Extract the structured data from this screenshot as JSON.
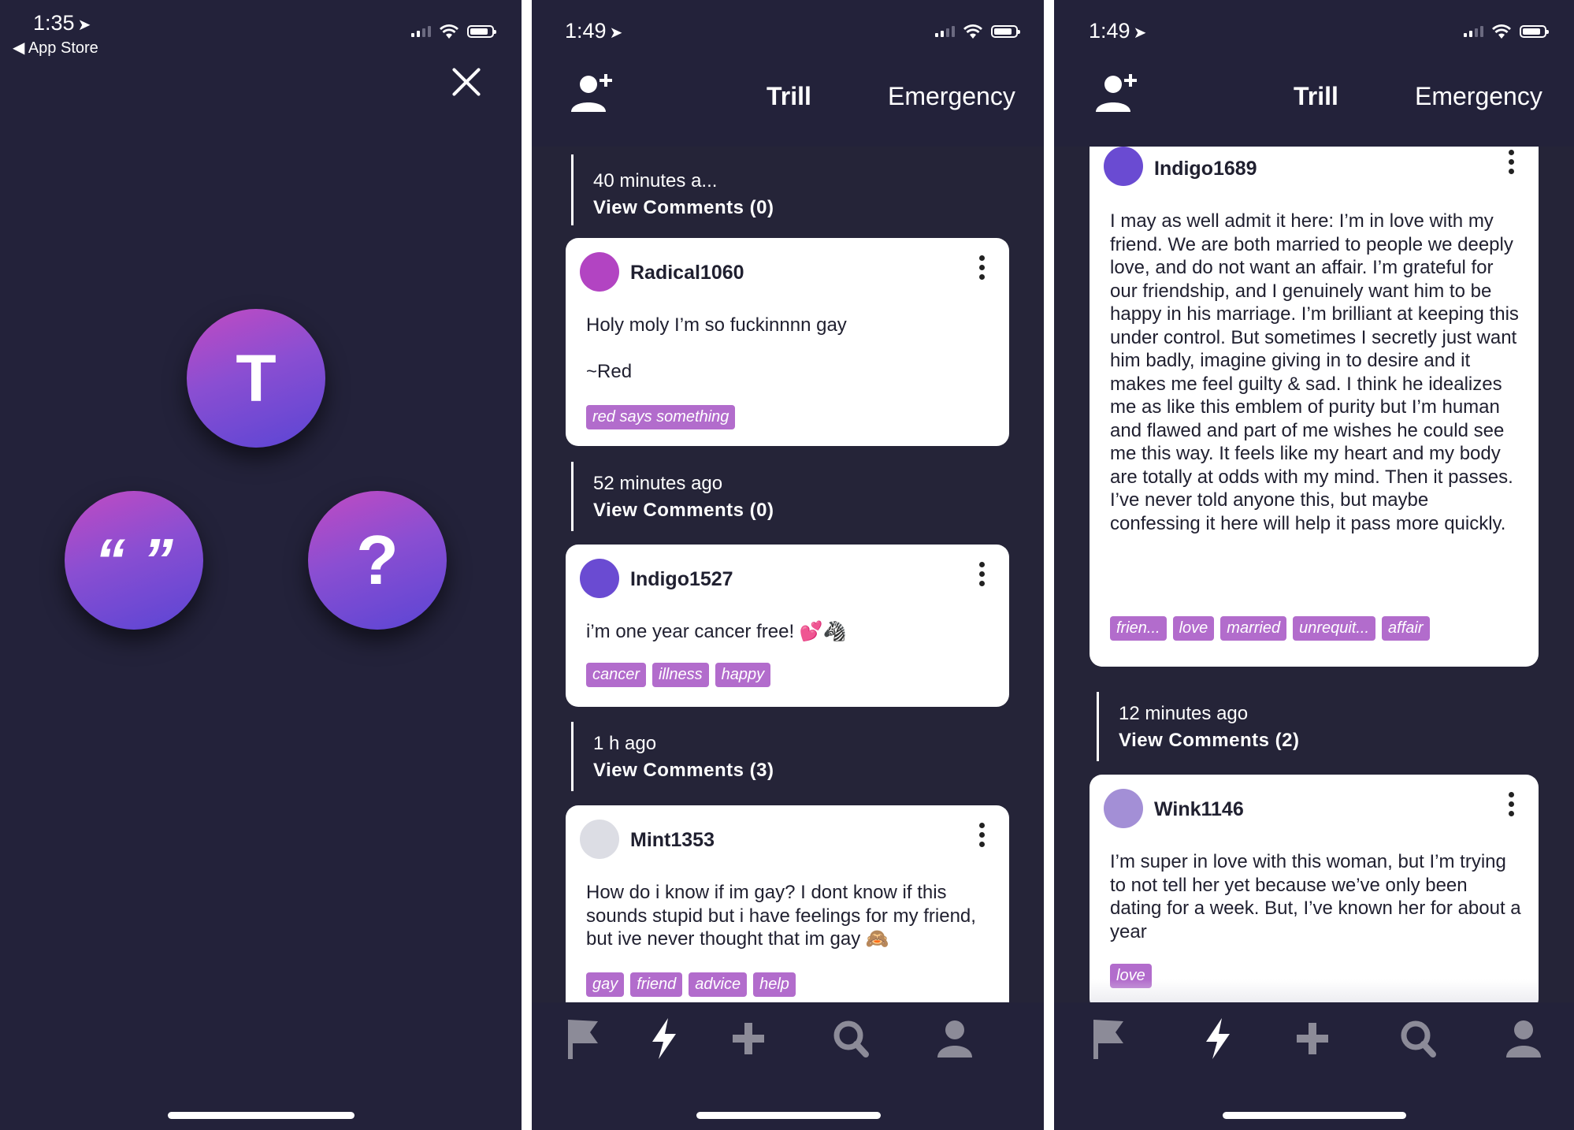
{
  "panel1": {
    "status_time": "1:35",
    "back_label": "App Store",
    "orbs": {
      "top": "T",
      "left": "“ ”",
      "right": "?"
    }
  },
  "panel2": {
    "status_time": "1:49",
    "tabs": {
      "main": "Trill",
      "secondary": "Emergency"
    },
    "meta_top": {
      "time": "40 minutes a...",
      "comments": "View Comments (0)"
    },
    "posts": [
      {
        "username": "Radical1060",
        "avatar_color": "#b244c2",
        "text": "Holy moly I’m so fuckinnnn gay",
        "text2": "~Red",
        "tags": [
          "red says something"
        ],
        "meta": {
          "time": "52 minutes ago",
          "comments": "View Comments (0)"
        }
      },
      {
        "username": "Indigo1527",
        "avatar_color": "#6a4bd2",
        "text": "i’m one year cancer free! 💕🦓",
        "tags": [
          "cancer",
          "illness",
          "happy"
        ],
        "meta": {
          "time": "1 h ago",
          "comments": "View Comments (3)"
        }
      },
      {
        "username": "Mint1353",
        "avatar_color": "#dcdde4",
        "text": "How do i know if im gay? I dont know if this sounds stupid but i have feelings for my friend, but ive never thought that im gay 🙈",
        "tags": [
          "gay",
          "friend",
          "advice",
          "help"
        ]
      }
    ]
  },
  "panel3": {
    "status_time": "1:49",
    "tabs": {
      "main": "Trill",
      "secondary": "Emergency"
    },
    "posts": [
      {
        "username": "Indigo1689",
        "avatar_color": "#6a4bd2",
        "text": "I may as well admit it here: I’m in love with my friend. We are both married to people we deeply love, and do not want an affair. I’m grateful for our friendship, and I genuinely want him to be happy in his marriage. I’m brilliant at keeping this under control. But sometimes I secretly just want him badly, imagine giving in to desire and it makes me feel guilty & sad. I think he idealizes me as like this emblem of purity but I’m human and flawed and part of me wishes he could see me this way. It feels like my heart and my body are totally at odds with my mind. Then it passes. I’ve never told anyone this, but maybe confessing it here will help it pass more quickly.",
        "tags": [
          "frien...",
          "love",
          "married",
          "unrequit...",
          "affair"
        ],
        "meta": {
          "time": "12 minutes ago",
          "comments": "View Comments (2)"
        }
      },
      {
        "username": "Wink1146",
        "avatar_color": "#a38fd6",
        "text": "I’m super in love with this woman, but I’m trying to not tell her yet because we’ve only been dating for a week. But, I’ve known her for about a year",
        "tags": [
          "love"
        ]
      }
    ]
  },
  "icons": {
    "nav": [
      "flag-icon",
      "bolt-icon",
      "plus-icon",
      "search-icon",
      "profile-icon"
    ],
    "header": "add-user-icon",
    "close": "close-icon"
  },
  "colors": {
    "background": "#23223a",
    "tag": "#b26ccc",
    "orb_gradient": [
      "#c14bc2",
      "#5a45d4"
    ],
    "active_nav": "#ffffff",
    "inactive_nav": "#8c8b98"
  }
}
